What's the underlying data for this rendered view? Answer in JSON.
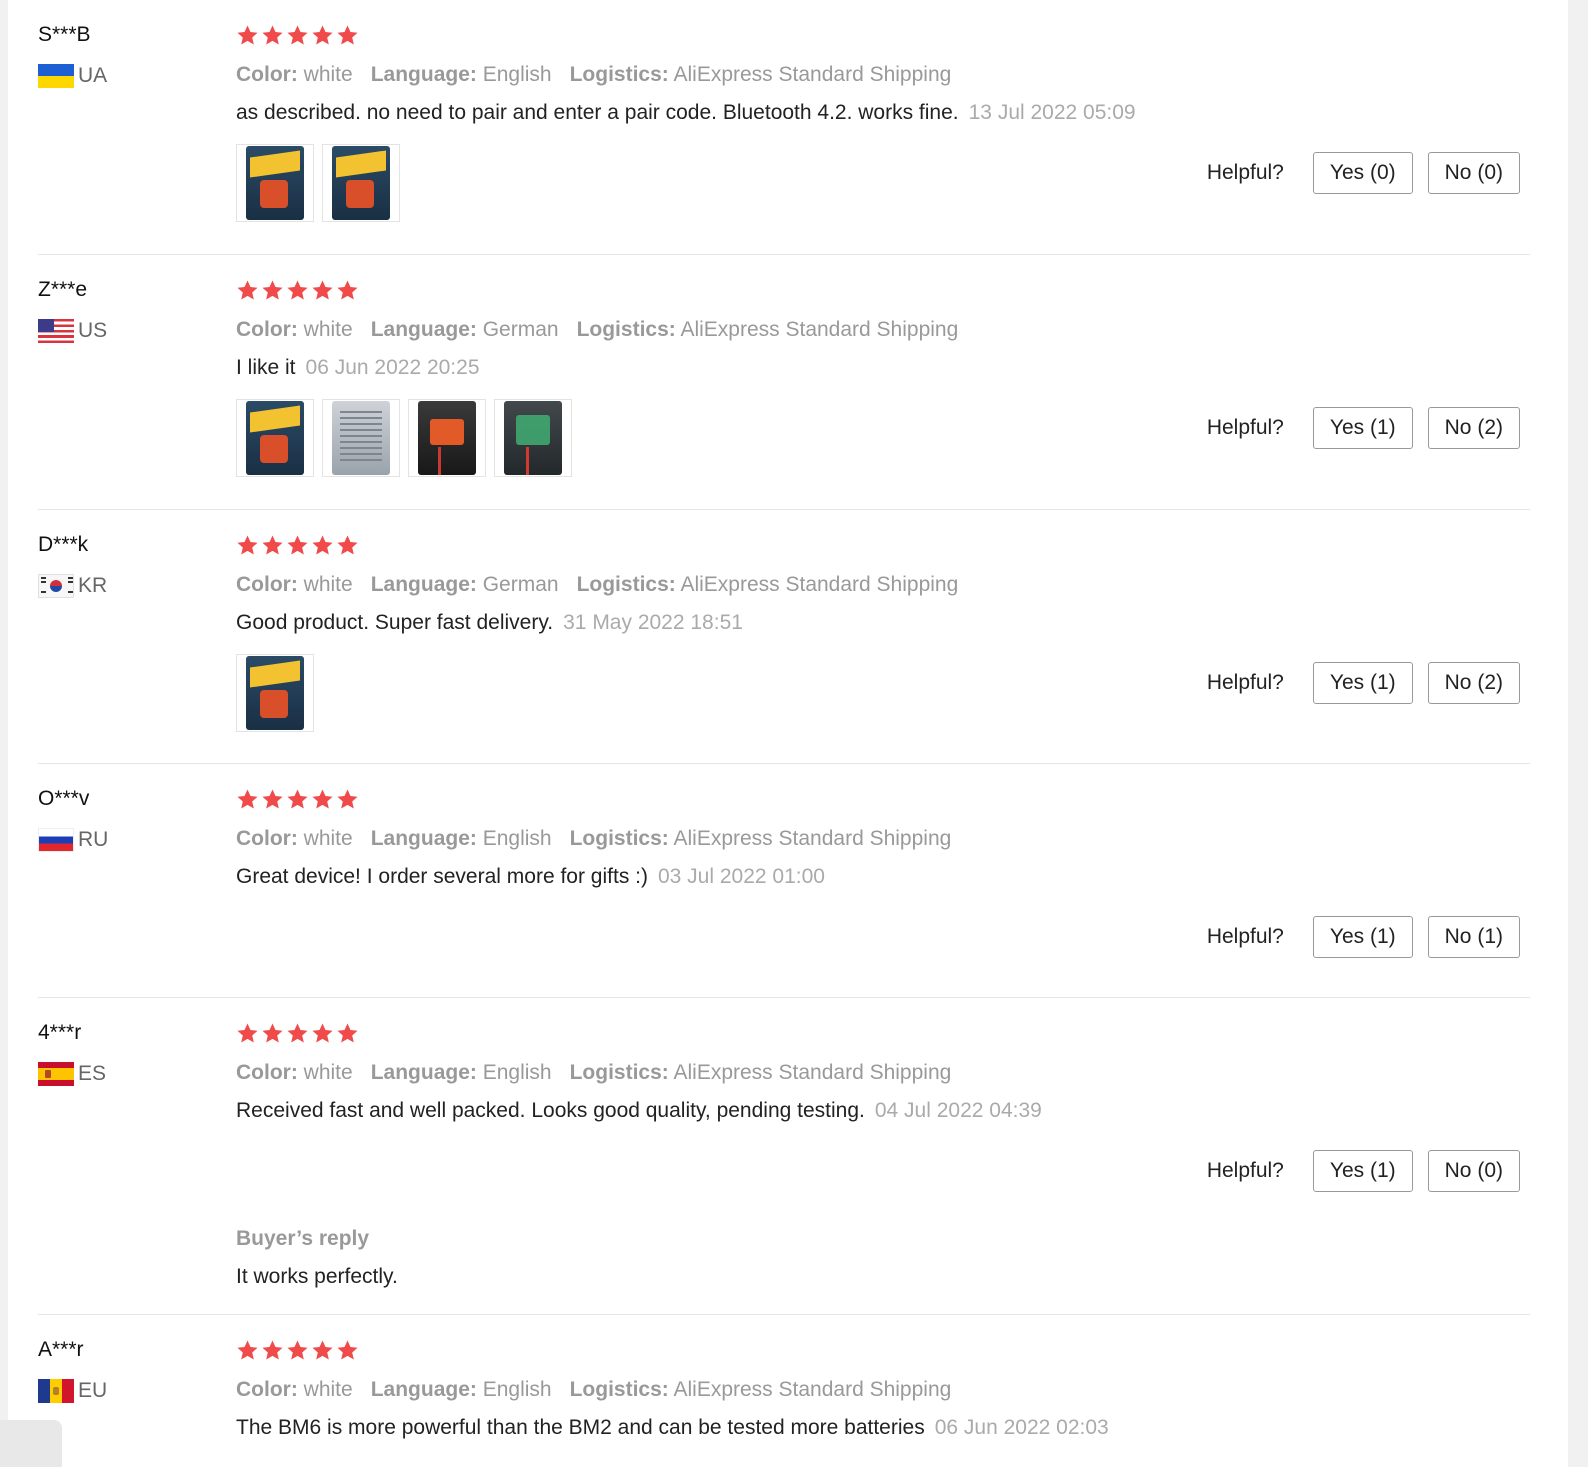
{
  "labels": {
    "color": "Color:",
    "language": "Language:",
    "logistics": "Logistics:",
    "helpful": "Helpful?"
  },
  "accent_color": "#f04a4a",
  "reviews": [
    {
      "user": "S***B",
      "country": "UA",
      "flag": "flag-ua",
      "rating": 5,
      "color": "white",
      "language": "English",
      "logistics": "AliExpress Standard Shipping",
      "text": "as described. no need to pair and enter a pair code. Bluetooth 4.2. works fine.",
      "date": "13 Jul 2022 05:09",
      "images": [
        "battery-monitor-package",
        "battery-monitor-package"
      ],
      "yes": "Yes (0)",
      "no": "No (0)"
    },
    {
      "user": "Z***e",
      "country": "US",
      "flag": "flag-us",
      "rating": 5,
      "color": "white",
      "language": "German",
      "logistics": "AliExpress Standard Shipping",
      "text": "I like it",
      "date": "06 Jun 2022 20:25",
      "images": [
        "battery-monitor-package",
        "package-back",
        "device",
        "device-clear"
      ],
      "yes": "Yes (1)",
      "no": "No (2)"
    },
    {
      "user": "D***k",
      "country": "KR",
      "flag": "flag-kr",
      "rating": 5,
      "color": "white",
      "language": "German",
      "logistics": "AliExpress Standard Shipping",
      "text": "Good product. Super fast delivery.",
      "date": "31 May 2022 18:51",
      "images": [
        "battery-monitor-package"
      ],
      "yes": "Yes (1)",
      "no": "No (2)"
    },
    {
      "user": "O***v",
      "country": "RU",
      "flag": "flag-ru",
      "rating": 5,
      "color": "white",
      "language": "English",
      "logistics": "AliExpress Standard Shipping",
      "text": "Great device! I order several more for gifts :)",
      "date": "03 Jul 2022 01:00",
      "images": [],
      "yes": "Yes (1)",
      "no": "No (1)"
    },
    {
      "user": "4***r",
      "country": "ES",
      "flag": "flag-es",
      "rating": 5,
      "color": "white",
      "language": "English",
      "logistics": "AliExpress Standard Shipping",
      "text": "Received fast and well packed. Looks good quality, pending testing.",
      "date": "04 Jul 2022 04:39",
      "images": [],
      "yes": "Yes (1)",
      "no": "No (0)",
      "reply": {
        "title": "Buyer’s reply",
        "text": "It works perfectly."
      }
    },
    {
      "user": "A***r",
      "country": "EU",
      "flag": "flag-eu",
      "rating": 5,
      "color": "white",
      "language": "English",
      "logistics": "AliExpress Standard Shipping",
      "text": "The BM6 is more powerful than the BM2 and can be tested more batteries",
      "date": "06 Jun 2022 02:03",
      "images": []
    }
  ]
}
